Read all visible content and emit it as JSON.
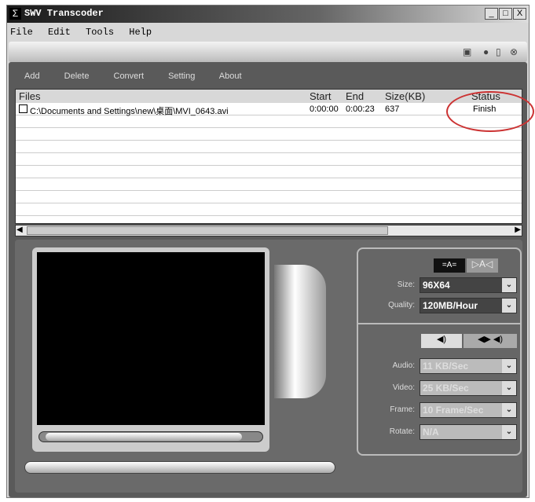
{
  "window": {
    "title": "SWV Transcoder",
    "controls": [
      "_",
      "□",
      "X"
    ]
  },
  "menu": [
    "File",
    "Edit",
    "Tools",
    "Help"
  ],
  "toolbar": [
    "Add",
    "Delete",
    "Convert",
    "Setting",
    "About"
  ],
  "list": {
    "columns": [
      "Files",
      "Start",
      "End",
      "Size(KB)",
      "Status"
    ],
    "rows": [
      {
        "file": "C:\\Documents and Settings\\new\\桌面\\MVI_0643.avi",
        "start": "0:00:00",
        "end": "0:00:23",
        "size": "637",
        "status": "Finish",
        "checked": false
      }
    ]
  },
  "settings": {
    "size": {
      "label": "Size:",
      "value": "96X64"
    },
    "quality": {
      "label": "Quality:",
      "value": "120MB/Hour"
    },
    "audio": {
      "label": "Audio:",
      "value": "11 KB/Sec"
    },
    "video": {
      "label": "Video:",
      "value": "25 KB/Sec"
    },
    "frame": {
      "label": "Frame:",
      "value": "10 Frame/Sec"
    },
    "rotate": {
      "label": "Rotate:",
      "value": "N/A"
    }
  },
  "annotation_color": "#cc3333"
}
